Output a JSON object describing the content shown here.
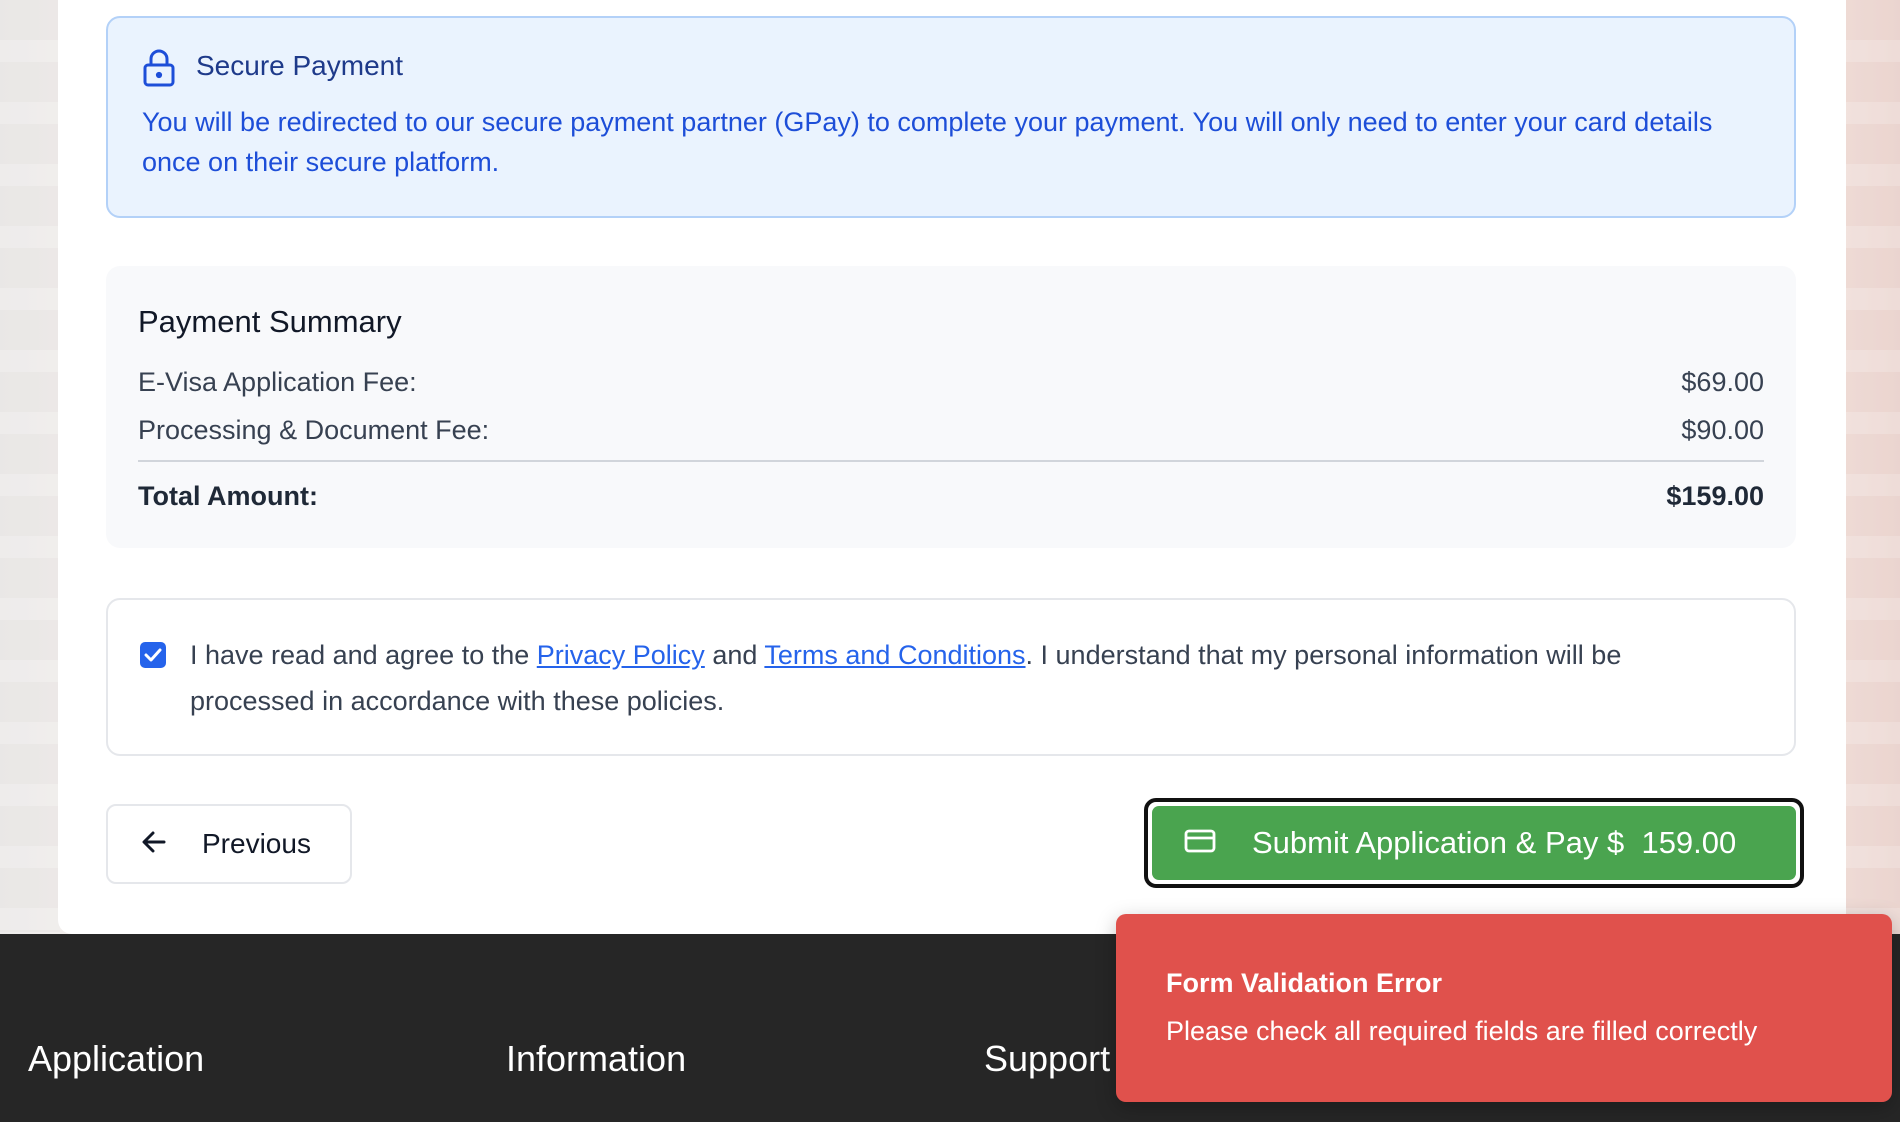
{
  "secure_payment": {
    "title": "Secure Payment",
    "icon": "lock-icon",
    "description": "You will be redirected to our secure payment partner (GPay) to complete your payment. You will only need to enter your card details once on their secure platform."
  },
  "payment_summary": {
    "title": "Payment Summary",
    "items": [
      {
        "label": "E-Visa Application Fee:",
        "amount": "$69.00"
      },
      {
        "label": "Processing & Document Fee:",
        "amount": "$90.00"
      }
    ],
    "total": {
      "label": "Total Amount:",
      "amount": "$159.00"
    }
  },
  "agreement": {
    "checked": true,
    "text_before": "I have read and agree to the ",
    "privacy_link": "Privacy Policy",
    "text_middle": " and ",
    "terms_link": "Terms and Conditions",
    "text_after": ". I understand that my personal information will be processed in accordance with these policies."
  },
  "navigation": {
    "previous_label": "Previous",
    "submit_label": "Submit Application & Pay",
    "submit_amount": "$  159.00"
  },
  "footer": {
    "columns": [
      "Application",
      "Information",
      "Support"
    ]
  },
  "toast": {
    "title": "Form Validation Error",
    "message": "Please check all required fields are filled correctly"
  },
  "colors": {
    "accent_blue": "#2563eb",
    "submit_green": "#4aa44f",
    "toast_red": "#e0514c",
    "footer_bg": "#262626"
  }
}
